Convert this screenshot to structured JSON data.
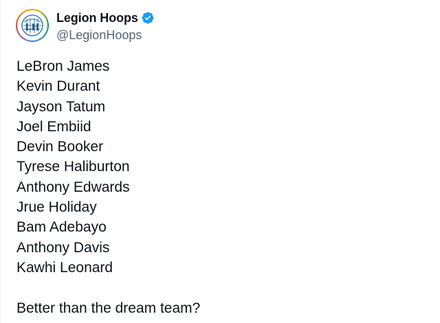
{
  "account": {
    "display_name": "Legion Hoops",
    "handle": "@LegionHoops",
    "avatar_icon": "legion-hoops-logo",
    "verified_icon": "verified-badge-icon",
    "verified_color": "#1d9bf0"
  },
  "tweet": {
    "players": [
      "LeBron James",
      "Kevin Durant",
      "Jayson Tatum",
      "Joel Embiid",
      "Devin Booker",
      "Tyrese Haliburton",
      "Anthony Edwards",
      "Jrue Holiday",
      "Bam Adebayo",
      "Anthony Davis",
      "Kawhi Leonard"
    ],
    "question": "Better than the dream team?"
  }
}
